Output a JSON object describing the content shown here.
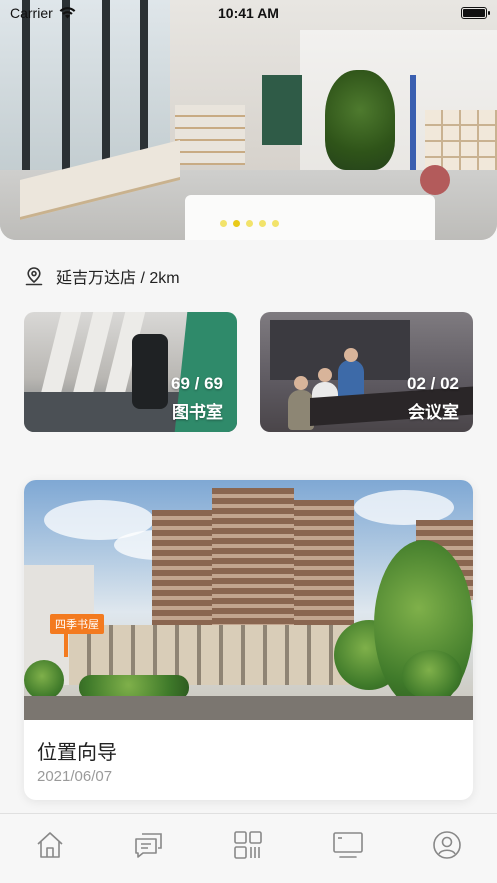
{
  "status_bar": {
    "carrier": "Carrier",
    "time": "10:41 AM"
  },
  "banner": {
    "dot_count": 5,
    "active_index": 1,
    "dot_color": "#f1e05a"
  },
  "location": {
    "text": "延吉万达店 / 2km",
    "icon": "location-pin-icon"
  },
  "rooms": [
    {
      "count": "69 / 69",
      "name": "图书室",
      "accent": "#2f8a6a"
    },
    {
      "count": "02 / 02",
      "name": "会议室"
    }
  ],
  "article": {
    "sign_text": "四季书屋",
    "title": "位置向导",
    "date": "2021/06/07"
  },
  "tabbar": {
    "items": [
      {
        "icon": "home-icon"
      },
      {
        "icon": "chat-icon"
      },
      {
        "icon": "qr-scan-icon"
      },
      {
        "icon": "screen-icon"
      },
      {
        "icon": "profile-icon"
      }
    ]
  }
}
